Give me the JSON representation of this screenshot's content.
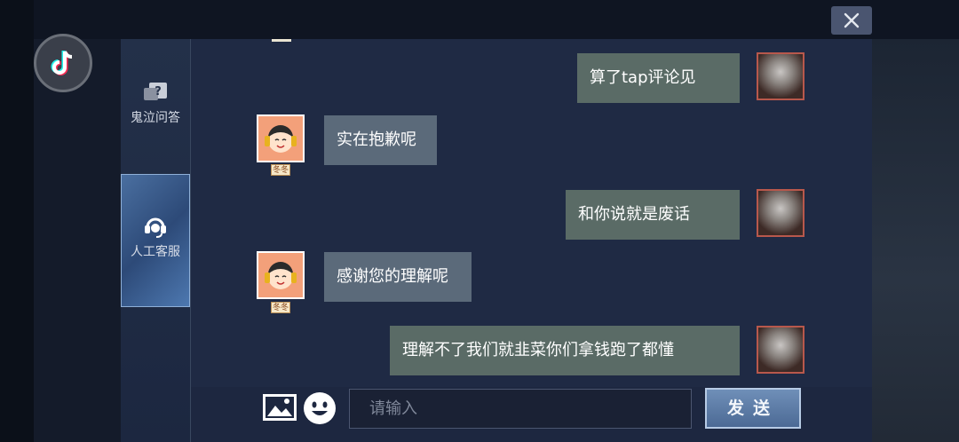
{
  "sidebar": {
    "items": [
      {
        "label": "鬼泣问答",
        "icon": "question-bubble-icon"
      },
      {
        "label": "人工客服",
        "icon": "headset-icon",
        "active": true
      }
    ]
  },
  "messages": [
    {
      "from": "user",
      "text": "算了tap评论见"
    },
    {
      "from": "agent",
      "text": "实在抱歉呢",
      "tag": "冬冬"
    },
    {
      "from": "user",
      "text": "和你说就是废话"
    },
    {
      "from": "agent",
      "text": "感谢您的理解呢",
      "tag": "冬冬"
    },
    {
      "from": "user",
      "text": "理解不了我们就韭菜你们拿钱跑了都懂"
    }
  ],
  "composer": {
    "placeholder": "请输入",
    "send_label": "发送"
  },
  "colors": {
    "user_bubble": "#5a6b66",
    "agent_bubble": "#5b6a7a",
    "chat_bg": "#1f2a44",
    "send_button": "#5c7ba6"
  }
}
